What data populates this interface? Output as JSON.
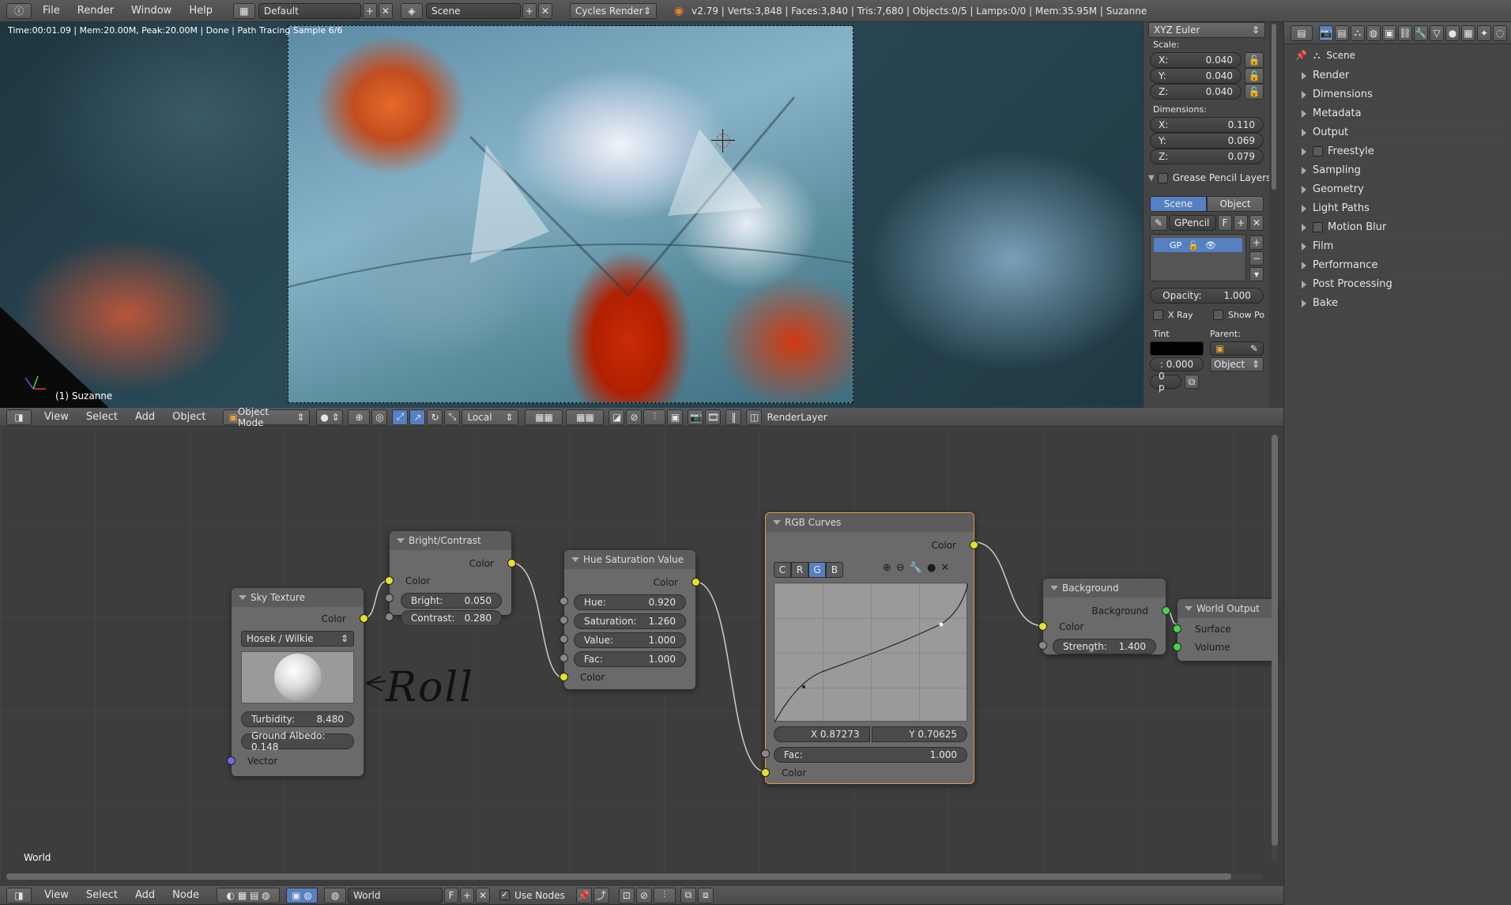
{
  "topbar": {
    "menus": [
      "File",
      "Render",
      "Window",
      "Help"
    ],
    "layout": "Default",
    "scene": "Scene",
    "engine": "Cycles Render",
    "stats": "v2.79 | Verts:3,848 | Faces:3,840 | Tris:7,680 | Objects:0/5 | Lamps:0/0 | Mem:35.95M | Suzanne"
  },
  "viewport": {
    "status": "Time:00:01.09 | Mem:20.00M, Peak:20.00M | Done | Path Tracing Sample 6/6",
    "object_label": "(1) Suzanne",
    "header": {
      "menus": [
        "View",
        "Select",
        "Add",
        "Object"
      ],
      "mode": "Object Mode",
      "orientation": "Local",
      "render_layer": "RenderLayer"
    }
  },
  "npanel": {
    "rotation_mode": "XYZ Euler",
    "scale_label": "Scale:",
    "scale": [
      {
        "axis": "X:",
        "value": "0.040"
      },
      {
        "axis": "Y:",
        "value": "0.040"
      },
      {
        "axis": "Z:",
        "value": "0.040"
      }
    ],
    "dimensions_label": "Dimensions:",
    "dimensions": [
      {
        "axis": "X:",
        "value": "0.110"
      },
      {
        "axis": "Y:",
        "value": "0.069"
      },
      {
        "axis": "Z:",
        "value": "0.079"
      }
    ],
    "grease_pencil_title": "Grease Pencil Layers",
    "gp_tabs": [
      "Scene",
      "Object"
    ],
    "gp_name": "GPencil",
    "gp_f": "F",
    "gp_layer": "GP",
    "opacity_label": "Opacity:",
    "opacity": "1.000",
    "xray": "X Ray",
    "show_po": "Show Po",
    "tint": "Tint",
    "parent": "Parent:",
    "tint_value": ": 0.000",
    "parent_type": "Object",
    "op": "0 p"
  },
  "properties": {
    "scene_label": "Scene",
    "panels": [
      "Render",
      "Dimensions",
      "Metadata",
      "Output",
      "Freestyle",
      "Sampling",
      "Geometry",
      "Light Paths",
      "Motion Blur",
      "Film",
      "Performance",
      "Post Processing",
      "Bake"
    ]
  },
  "nodes": {
    "sky": {
      "title": "Sky Texture",
      "out": "Color",
      "type": "Hosek / Wilkie",
      "turbidity_label": "Turbidity:",
      "turbidity": "8.480",
      "albedo": "Ground Albedo: 0.148",
      "vector": "Vector"
    },
    "bc": {
      "title": "Bright/Contrast",
      "out": "Color",
      "in": "Color",
      "bright_label": "Bright:",
      "bright": "0.050",
      "contrast_label": "Contrast:",
      "contrast": "0.280"
    },
    "hsv": {
      "title": "Hue Saturation Value",
      "out": "Color",
      "hue_label": "Hue:",
      "hue": "0.920",
      "sat_label": "Saturation:",
      "sat": "1.260",
      "val_label": "Value:",
      "val": "1.000",
      "fac_label": "Fac:",
      "fac": "1.000",
      "in": "Color"
    },
    "curves": {
      "title": "RGB Curves",
      "out": "Color",
      "channels": [
        "C",
        "R",
        "G",
        "B"
      ],
      "x": "X 0.87273",
      "y": "Y 0.70625",
      "fac_label": "Fac:",
      "fac": "1.000",
      "in": "Color"
    },
    "bg": {
      "title": "Background",
      "out": "Background",
      "in": "Color",
      "strength_label": "Strength:",
      "strength": "1.400"
    },
    "wo": {
      "title": "World Output",
      "surface": "Surface",
      "volume": "Volume"
    },
    "annotation": "Roll",
    "frame_label": "World"
  },
  "node_header": {
    "menus": [
      "View",
      "Select",
      "Add",
      "Node"
    ],
    "world": "World",
    "f": "F",
    "use_nodes": "Use Nodes"
  },
  "colors": {
    "accent": "#5680c2",
    "socket_yellow": "#e6df2e",
    "socket_green": "#4ad04a",
    "curves_border": "#e29a3c"
  }
}
